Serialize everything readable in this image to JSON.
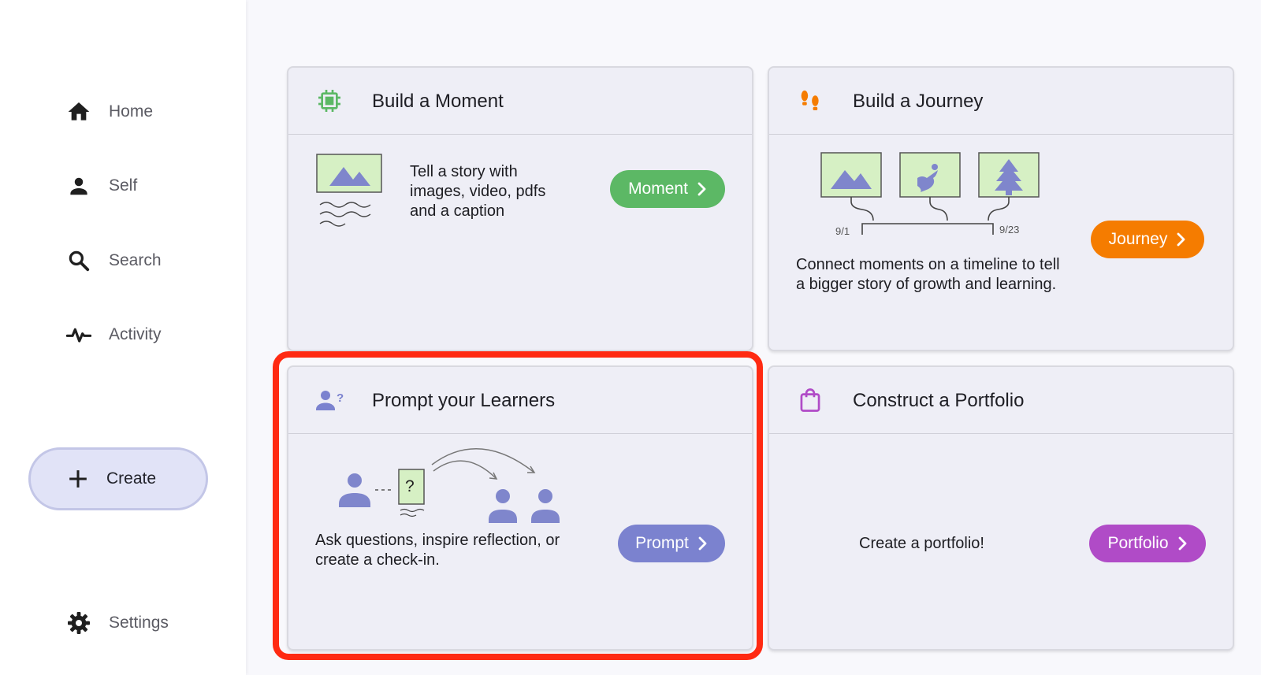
{
  "sidebar": {
    "items": [
      {
        "label": "Home",
        "icon": "home-icon"
      },
      {
        "label": "Self",
        "icon": "person-icon"
      },
      {
        "label": "Search",
        "icon": "search-icon"
      },
      {
        "label": "Activity",
        "icon": "activity-icon"
      }
    ],
    "create_label": "Create",
    "settings_label": "Settings"
  },
  "cards": {
    "moment": {
      "title": "Build a Moment",
      "description": "Tell a story with images, video, pdfs and a caption",
      "button": "Moment",
      "accent": "#5cb865",
      "icon": "chip-icon"
    },
    "journey": {
      "title": "Build a Journey",
      "description": "Connect moments on a timeline to tell a bigger story of growth and learning.",
      "button": "Journey",
      "accent": "#f57c00",
      "icon": "footprints-icon",
      "timeline_start": "9/1",
      "timeline_end": "9/23"
    },
    "prompt": {
      "title": "Prompt your Learners",
      "description": "Ask questions, inspire reflection, or create a check-in.",
      "button": "Prompt",
      "accent": "#7b82cf",
      "icon": "person-question-icon",
      "question_mark": "?"
    },
    "portfolio": {
      "title": "Construct a Portfolio",
      "description": "Create a portfolio!",
      "button": "Portfolio",
      "accent": "#b04bc7",
      "icon": "bag-icon"
    }
  },
  "colors": {
    "highlight": "#ff2a12",
    "illustration_fill": "#d6f0c4",
    "illustration_shape": "#7f86cc"
  }
}
